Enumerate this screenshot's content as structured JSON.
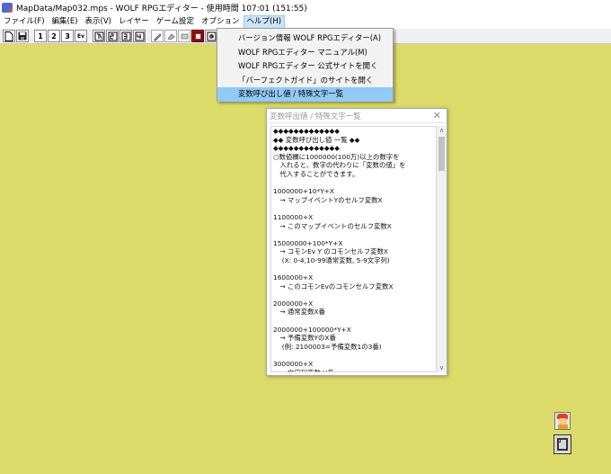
{
  "window": {
    "title": "MapData/Map032.mps - WOLF RPGエディター - 使用時間 107:01 (151:55)"
  },
  "menubar": {
    "items": [
      {
        "label": "ファイル(F)",
        "active": false
      },
      {
        "label": "編集(E)",
        "active": false
      },
      {
        "label": "表示(V)",
        "active": false
      },
      {
        "label": "レイヤー",
        "active": false
      },
      {
        "label": "ゲーム設定",
        "active": false
      },
      {
        "label": "オプション",
        "active": false
      },
      {
        "label": "ヘルプ(H)",
        "active": true
      }
    ]
  },
  "toolbar": {
    "layer_buttons": [
      "1",
      "2",
      "3",
      "Ev"
    ]
  },
  "help_menu": {
    "items": [
      {
        "label": "バージョン情報 WOLF RPGエディター(A)",
        "highlighted": false
      },
      {
        "label": "WOLF RPGエディター マニュアル(M)",
        "highlighted": false
      },
      {
        "label": "WOLF RPGエディター 公式サイトを開く",
        "highlighted": false
      },
      {
        "label": "「パーフェクトガイド」のサイトを開く",
        "highlighted": false
      },
      {
        "label": "変数呼び出し値 / 特殊文字一覧",
        "highlighted": true
      }
    ]
  },
  "dialog": {
    "title": "変数呼出値 / 特殊文字一覧",
    "lines": [
      "◆◆◆◆◆◆◆◆◆◆◆◆◆",
      "◆◆ 変数呼び出し値 一覧 ◆◆",
      "◆◆◆◆◆◆◆◆◆◆◆◆◆",
      "○数値欄に1000000(100万)以上の数字を",
      "　入れると、数字の代わりに「変数の値」を",
      "　代入することができます。",
      "",
      "1000000+10*Y+X",
      "　→ マップイベントYのセルフ変数X",
      "",
      "1100000+X",
      "　→ このマップイベントのセルフ変数X",
      "",
      "15000000+100*Y+X",
      "　→ コモンEv Y のコモンセルフ変数X",
      "　 (X: 0-4,10-99通常変数, 5-9文字列)",
      "",
      "1600000+X",
      "　→ このコモンEvのコモンセルフ変数X",
      "",
      "2000000+X",
      "　→ 通常変数X番",
      "",
      "2000000+100000*Y+X",
      "　→ 予備変数YのX番",
      "　 (例: 2100003=予備変数1の3番)",
      "",
      "3000000+X",
      "　→ 文字列変数 X番"
    ]
  }
}
